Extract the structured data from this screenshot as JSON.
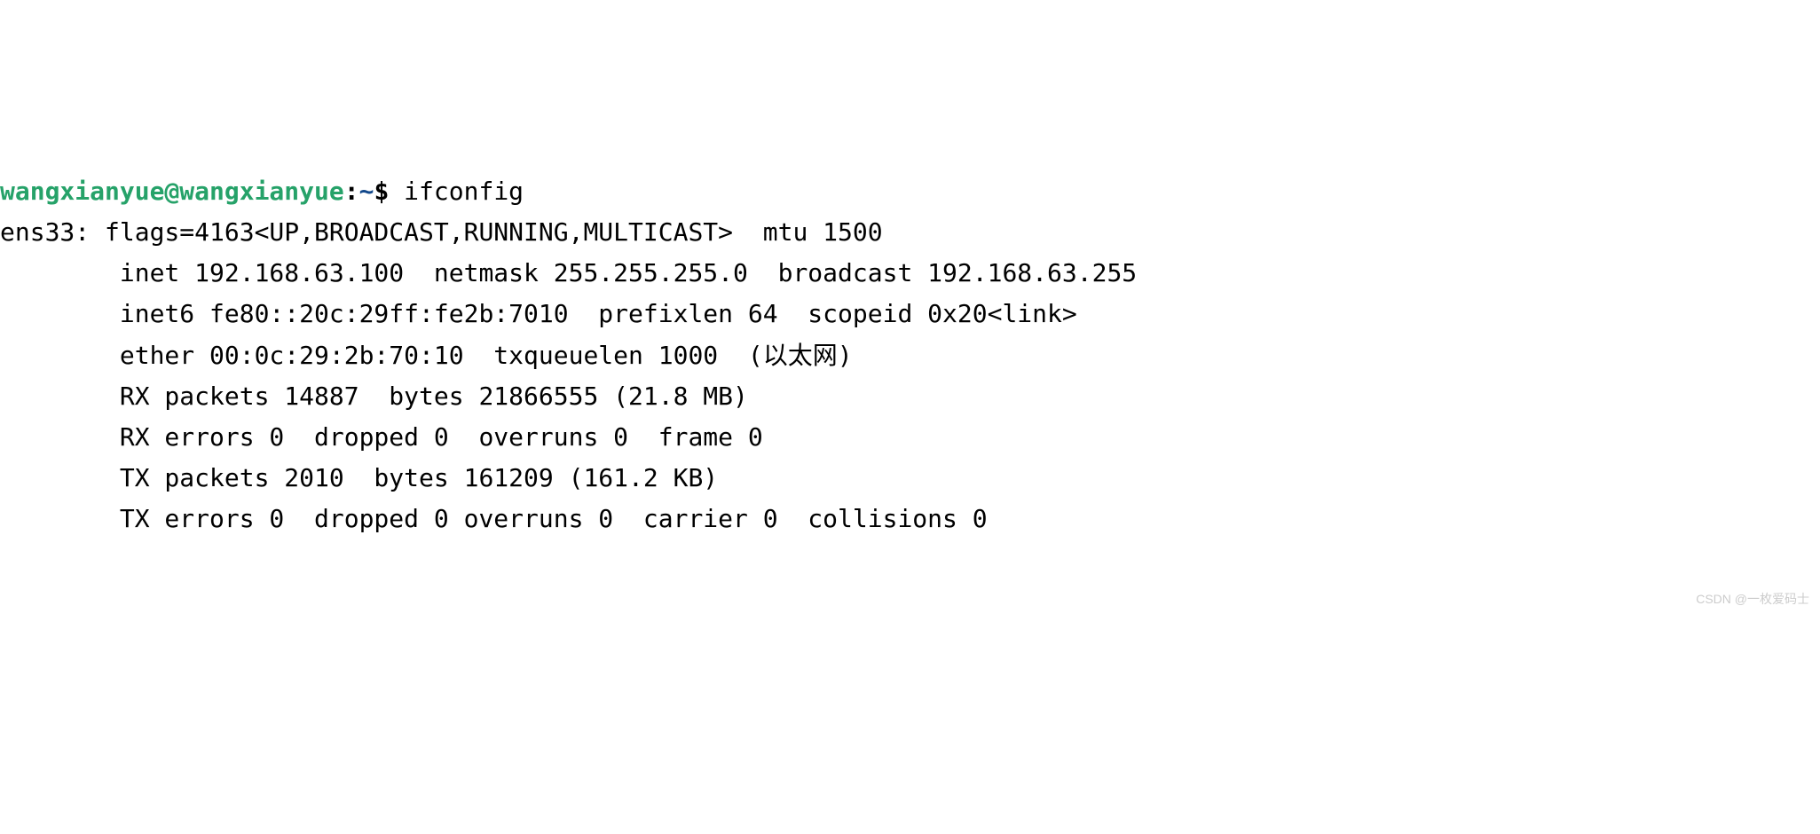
{
  "prompt": {
    "user_host": "wangxianyue@wangxianyue",
    "sep1": ":",
    "path": "~",
    "sep2": "$",
    "command": "ifconfig"
  },
  "output": {
    "line1": "ens33: flags=4163<UP,BROADCAST,RUNNING,MULTICAST>  mtu 1500",
    "line2": "        inet 192.168.63.100  netmask 255.255.255.0  broadcast 192.168.63.255",
    "line3": "        inet6 fe80::20c:29ff:fe2b:7010  prefixlen 64  scopeid 0x20<link>",
    "line4": "        ether 00:0c:29:2b:70:10  txqueuelen 1000  (以太网)",
    "line5": "        RX packets 14887  bytes 21866555 (21.8 MB)",
    "line6": "        RX errors 0  dropped 0  overruns 0  frame 0",
    "line7": "        TX packets 2010  bytes 161209 (161.2 KB)",
    "line8": "        TX errors 0  dropped 0 overruns 0  carrier 0  collisions 0"
  },
  "watermark": "CSDN @一枚爱码士"
}
